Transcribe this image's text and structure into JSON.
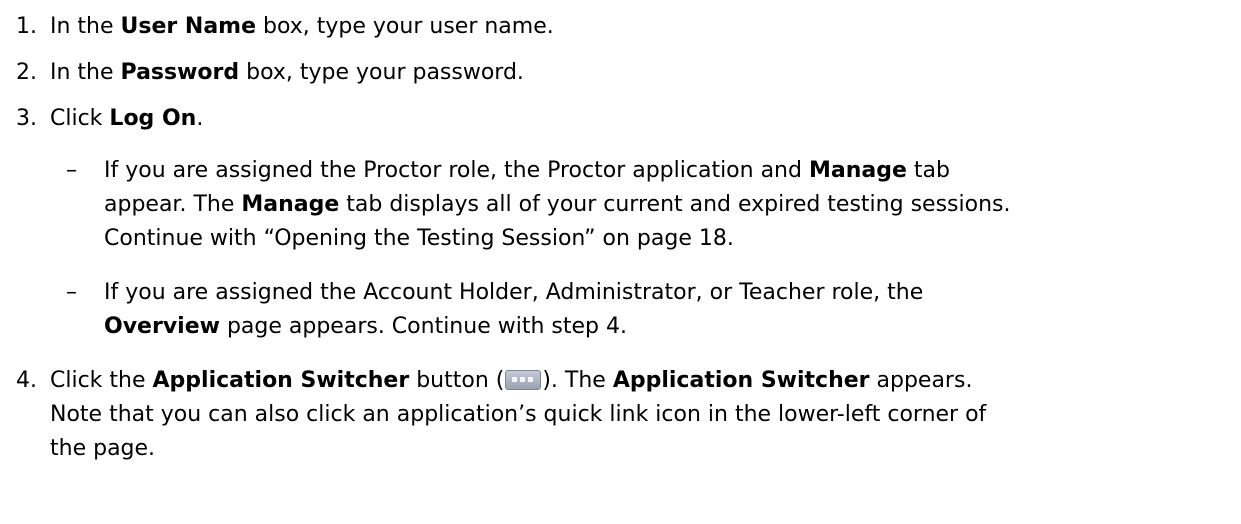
{
  "steps": [
    {
      "num": "1.",
      "pre": "In the ",
      "bold": "User Name",
      "post": " box, type your user name."
    },
    {
      "num": "2.",
      "pre": "In the ",
      "bold": "Password",
      "post": " box, type your password."
    },
    {
      "num": "3.",
      "pre": "Click ",
      "bold": "Log On",
      "post": "."
    }
  ],
  "bullet1": {
    "dash": "–",
    "line1_pre": "If you are assigned the Proctor role, the Proctor application and ",
    "line1_bold": "Manage",
    "line1_post": " tab",
    "line2_pre": "appear. The ",
    "line2_bold": "Manage",
    "line2_post": " tab displays all of your current and expired testing sessions.",
    "line3": "Continue with “Opening the Testing Session” on page 18."
  },
  "bullet2": {
    "dash": "–",
    "line1": "If you are assigned the Account Holder, Administrator, or Teacher role, the",
    "line2_bold": "Overview",
    "line2_post": " page appears. Continue with step 4."
  },
  "step4": {
    "num": "4.",
    "pre": "Click the ",
    "bold1": "Application Switcher",
    "mid1": " button (",
    "icon": "application-switcher-icon",
    "mid2": "). The ",
    "bold2": "Application Switcher",
    "post": " appears.",
    "line2": "Note that you can also click an application’s quick link icon in the lower-left corner of",
    "line3": "the page."
  }
}
